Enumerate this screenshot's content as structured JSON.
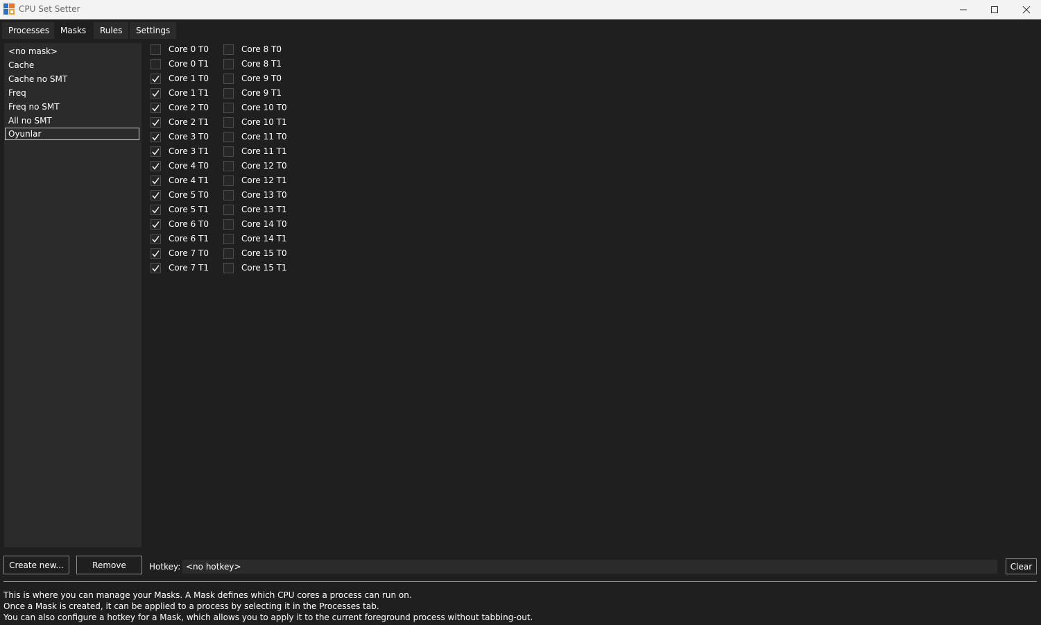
{
  "window": {
    "title": "CPU Set Setter"
  },
  "tabs": [
    {
      "label": "Processes"
    },
    {
      "label": "Masks"
    },
    {
      "label": "Rules"
    },
    {
      "label": "Settings"
    }
  ],
  "masks": [
    {
      "label": "<no mask>"
    },
    {
      "label": "Cache"
    },
    {
      "label": "Cache no SMT"
    },
    {
      "label": "Freq"
    },
    {
      "label": "Freq no SMT"
    },
    {
      "label": "All no SMT"
    },
    {
      "label": "Oyunlar",
      "selected": true
    }
  ],
  "cores_left": [
    {
      "label": "Core 0 T0",
      "checked": false
    },
    {
      "label": "Core 0 T1",
      "checked": false
    },
    {
      "label": "Core 1 T0",
      "checked": true
    },
    {
      "label": "Core 1 T1",
      "checked": true
    },
    {
      "label": "Core 2 T0",
      "checked": true
    },
    {
      "label": "Core 2 T1",
      "checked": true
    },
    {
      "label": "Core 3 T0",
      "checked": true
    },
    {
      "label": "Core 3 T1",
      "checked": true
    },
    {
      "label": "Core 4 T0",
      "checked": true
    },
    {
      "label": "Core 4 T1",
      "checked": true
    },
    {
      "label": "Core 5 T0",
      "checked": true
    },
    {
      "label": "Core 5 T1",
      "checked": true
    },
    {
      "label": "Core 6 T0",
      "checked": true
    },
    {
      "label": "Core 6 T1",
      "checked": true
    },
    {
      "label": "Core 7 T0",
      "checked": true
    },
    {
      "label": "Core 7 T1",
      "checked": true
    }
  ],
  "cores_right": [
    {
      "label": "Core 8 T0",
      "checked": false
    },
    {
      "label": "Core 8 T1",
      "checked": false
    },
    {
      "label": "Core 9 T0",
      "checked": false
    },
    {
      "label": "Core 9 T1",
      "checked": false
    },
    {
      "label": "Core 10 T0",
      "checked": false
    },
    {
      "label": "Core 10 T1",
      "checked": false
    },
    {
      "label": "Core 11 T0",
      "checked": false
    },
    {
      "label": "Core 11 T1",
      "checked": false
    },
    {
      "label": "Core 12 T0",
      "checked": false
    },
    {
      "label": "Core 12 T1",
      "checked": false
    },
    {
      "label": "Core 13 T0",
      "checked": false
    },
    {
      "label": "Core 13 T1",
      "checked": false
    },
    {
      "label": "Core 14 T0",
      "checked": false
    },
    {
      "label": "Core 14 T1",
      "checked": false
    },
    {
      "label": "Core 15 T0",
      "checked": false
    },
    {
      "label": "Core 15 T1",
      "checked": false
    }
  ],
  "buttons": {
    "create": "Create new...",
    "remove": "Remove",
    "clear": "Clear"
  },
  "hotkey": {
    "label": "Hotkey:",
    "value": "<no hotkey>"
  },
  "help": {
    "line1": "This is where you can manage your Masks. A Mask defines which CPU cores a process can run on.",
    "line2": "Once a Mask is created, it can be applied to a process by selecting it in the Processes tab.",
    "line3": "You can also configure a hotkey for a Mask, which allows you to apply it to the current foreground process without tabbing-out."
  },
  "colors": {
    "background": "#1f1f1f",
    "panel": "#2b2b2b",
    "titlebar": "#f3f3f3"
  },
  "icons": {
    "app": "app-icon",
    "minimize": "minimize-icon",
    "maximize": "maximize-icon",
    "close": "close-icon",
    "check": "checkmark-icon"
  }
}
